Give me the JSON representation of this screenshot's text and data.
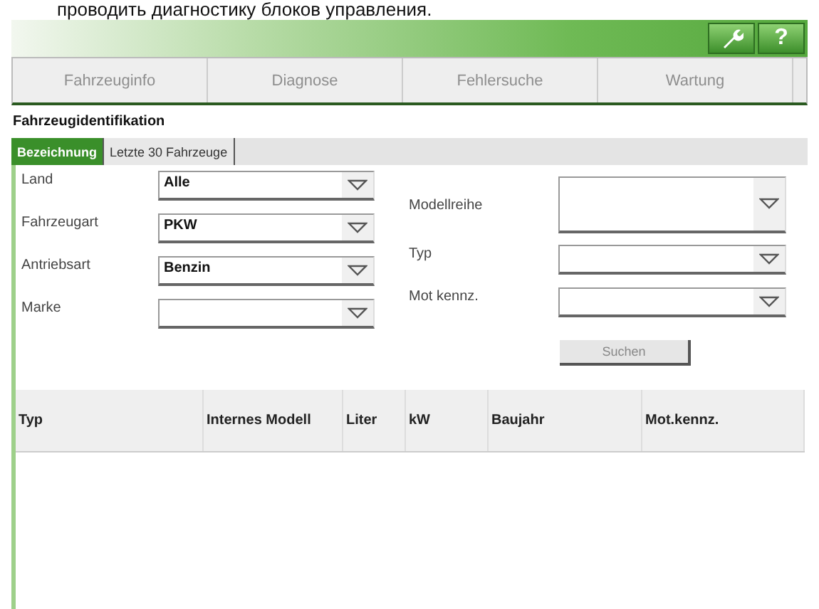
{
  "caption": "проводить диагностику блоков управления.",
  "header_buttons": [
    {
      "kind": "wrench"
    },
    {
      "kind": "help",
      "label": "?"
    }
  ],
  "main_tabs": [
    {
      "label": "Fahrzeuginfo",
      "disabled": true
    },
    {
      "label": "Diagnose",
      "disabled": true
    },
    {
      "label": "Fehlersuche",
      "disabled": true
    },
    {
      "label": "Wartung",
      "disabled": true
    }
  ],
  "section_title": "Fahrzeugidentifikation",
  "sub_tabs": [
    {
      "label": "Bezeichnung",
      "selected": true
    },
    {
      "label": "Letzte 30 Fahrzeuge",
      "selected": false
    }
  ],
  "left_fields": [
    {
      "label": "Land",
      "value": "Alle"
    },
    {
      "label": "Fahrzeugart",
      "value": "PKW"
    },
    {
      "label": "Antriebsart",
      "value": "Benzin"
    },
    {
      "label": "Marke"
    }
  ],
  "right_fields": [
    {
      "label": "Modellreihe",
      "tall": true
    },
    {
      "label": "Typ",
      "tall": false
    },
    {
      "label": "Mot kennz.",
      "tall": false
    }
  ],
  "search_button": {
    "label": "Suchen",
    "disabled": true
  },
  "table": {
    "columns": [
      "Typ",
      "Internes Modell",
      "Liter",
      "kW",
      "Baujahr",
      "Mot.kennz."
    ]
  }
}
